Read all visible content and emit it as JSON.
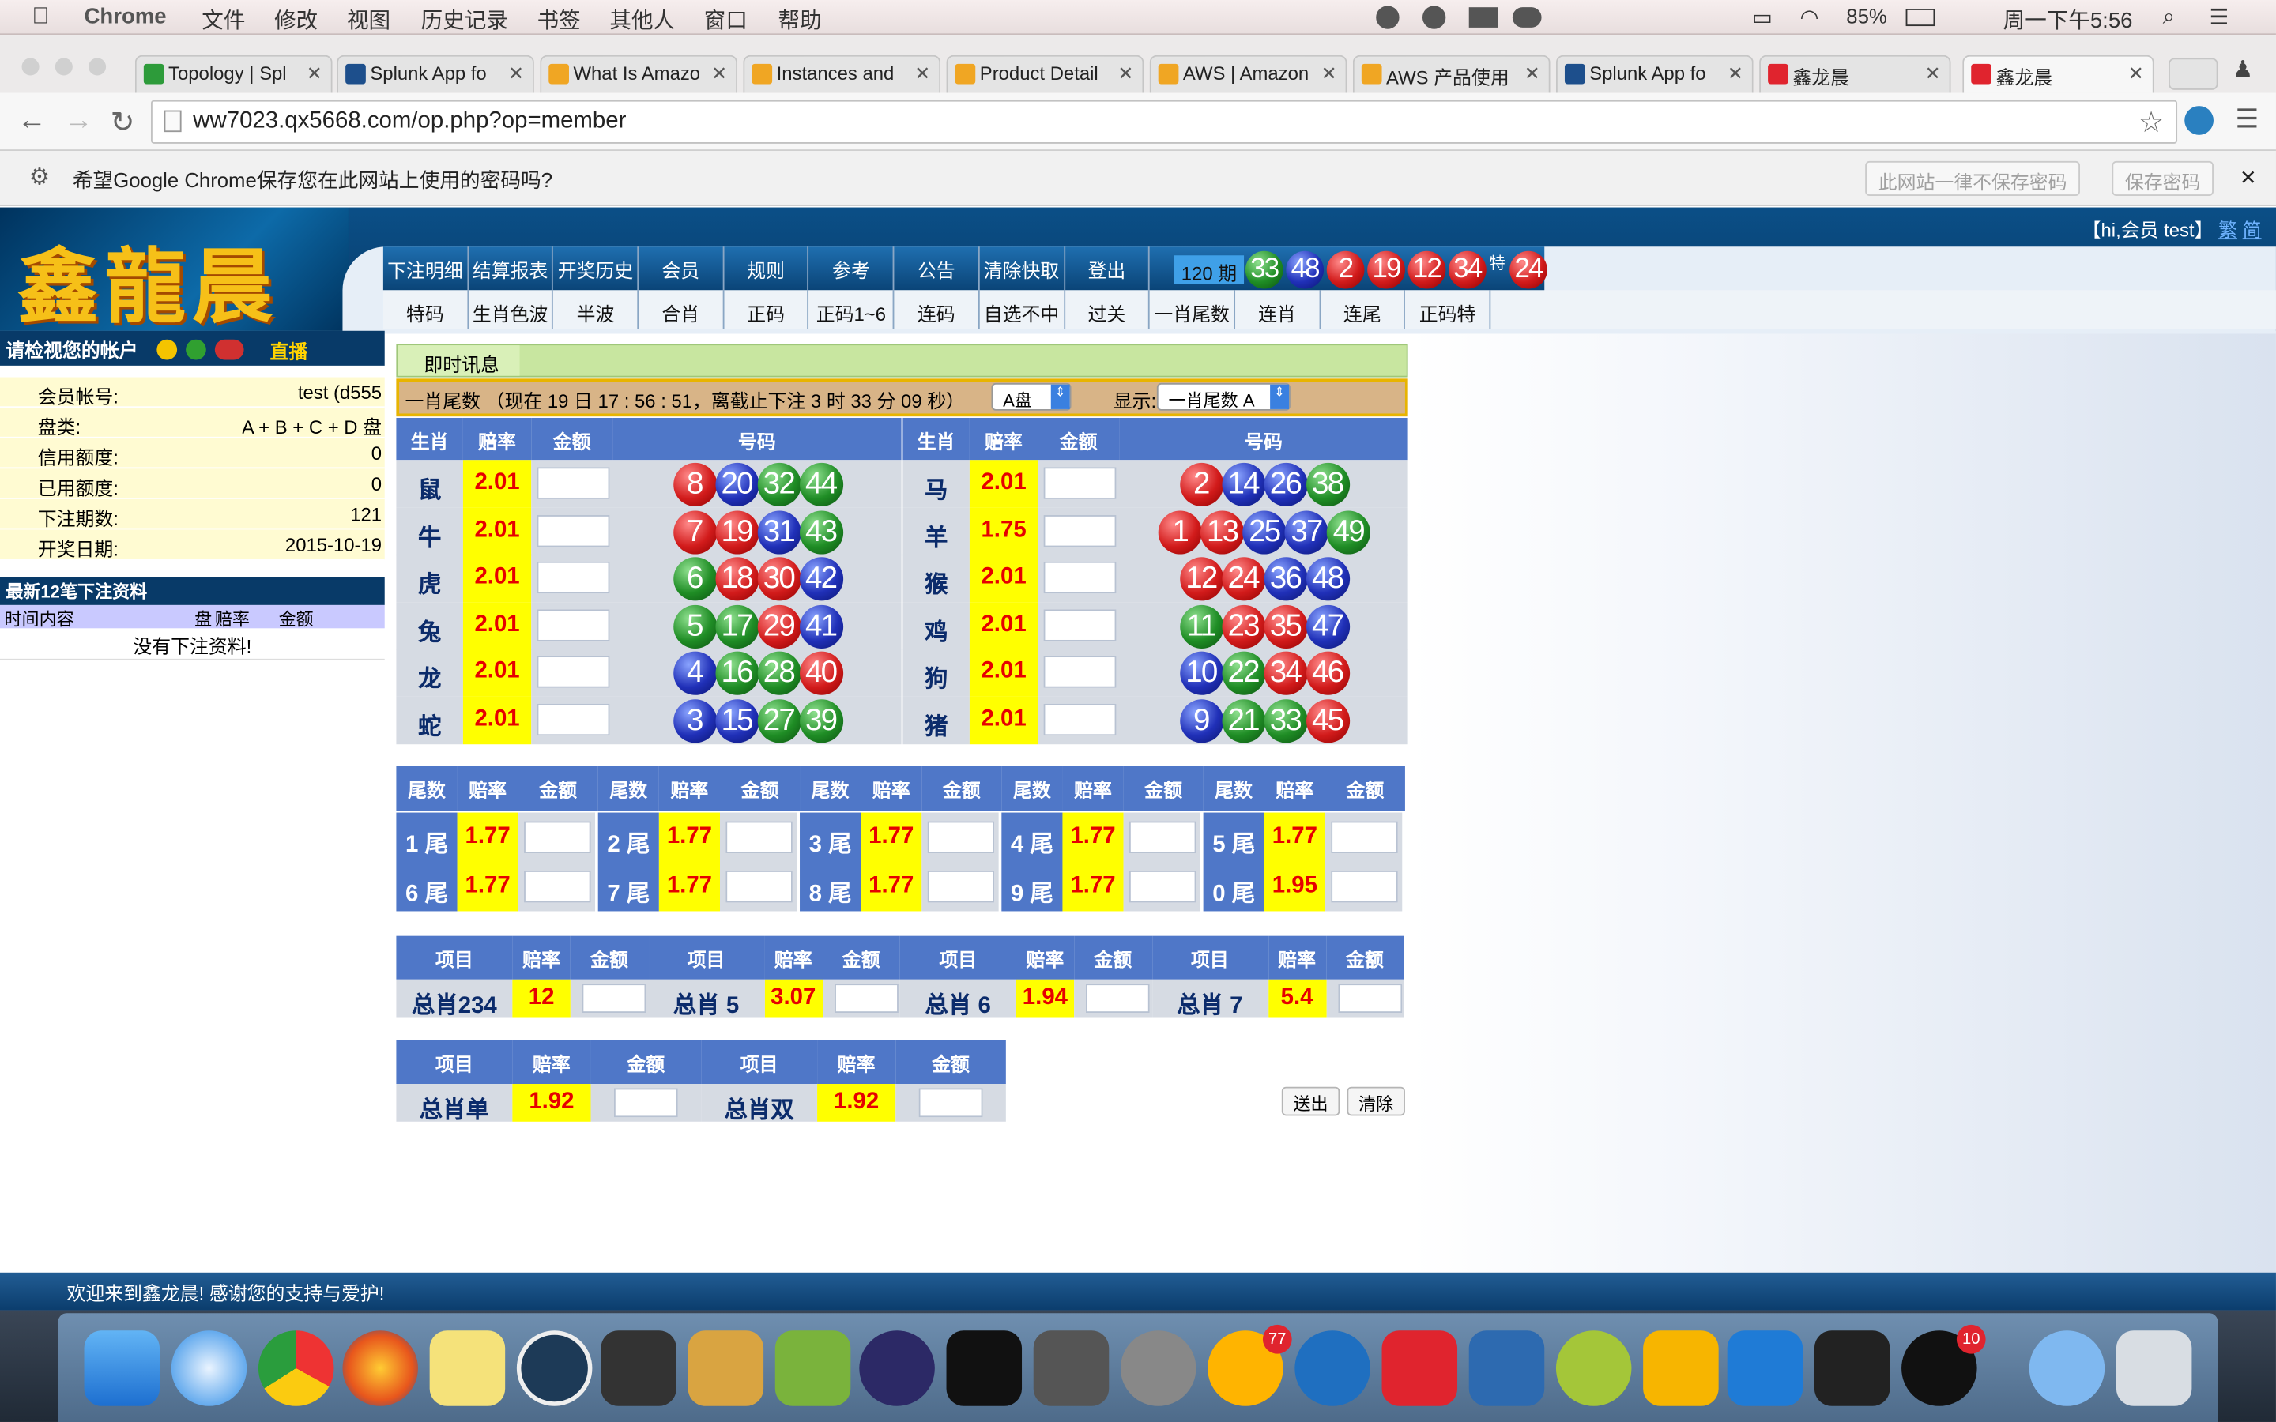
{
  "mac_menu": {
    "app": "Chrome",
    "items": [
      "文件",
      "修改",
      "视图",
      "历史记录",
      "书签",
      "其他人",
      "窗口",
      "帮助"
    ],
    "battery": "85%",
    "clock": "周一下午5:56"
  },
  "tabs": [
    {
      "label": "Topology | Spl",
      "color": "#2d9b3a"
    },
    {
      "label": "Splunk App fo",
      "color": "#1d4f8c"
    },
    {
      "label": "What Is Amazo",
      "color": "#f0a623"
    },
    {
      "label": "Instances and",
      "color": "#f0a623"
    },
    {
      "label": "Product Detail",
      "color": "#f0a623"
    },
    {
      "label": "AWS | Amazon",
      "color": "#f0a623"
    },
    {
      "label": "AWS 产品使用",
      "color": "#f0a623"
    },
    {
      "label": "Splunk App fo",
      "color": "#1d4f8c"
    },
    {
      "label": "鑫龙晨",
      "color": "#e0242e"
    },
    {
      "label": "鑫龙晨",
      "color": "#e0242e"
    }
  ],
  "url": "ww7023.qx5668.com/op.php?op=member",
  "pw_prompt": {
    "text": "希望Google Chrome保存您在此网站上使用的密码吗?",
    "never_btn": "此网站一律不保存密码",
    "save_btn": "保存密码"
  },
  "site": {
    "logo": "鑫龍晨",
    "user_greeting": "【hi,会员 test】",
    "trad": "繁",
    "simp": "简",
    "nav_top": [
      "下注明细",
      "结算报表",
      "开奖历史",
      "会员",
      "规则",
      "参考",
      "公告",
      "清除快取",
      "登出"
    ],
    "nav_bottom": [
      "特码",
      "生肖色波",
      "半波",
      "合肖",
      "正码",
      "正码1~6",
      "连码",
      "自选不中",
      "过关",
      "一肖尾数",
      "连肖",
      "连尾",
      "正码特"
    ],
    "draw_period": "120 期",
    "draw_balls": [
      {
        "n": "33",
        "c": "green"
      },
      {
        "n": "48",
        "c": "blue"
      },
      {
        "n": "2",
        "c": "red"
      },
      {
        "n": "19",
        "c": "red"
      },
      {
        "n": "12",
        "c": "red"
      },
      {
        "n": "34",
        "c": "red"
      }
    ],
    "special_label": "特",
    "special_ball": {
      "n": "24",
      "c": "red"
    }
  },
  "account": {
    "title": "请检视您的帐户",
    "live": "直播",
    "rows": [
      {
        "k": "会员帐号:",
        "v": "test (d555"
      },
      {
        "k": "盘类:",
        "v": "A + B + C + D 盘"
      },
      {
        "k": "信用额度:",
        "v": "0"
      },
      {
        "k": "已用额度:",
        "v": "0"
      },
      {
        "k": "下注期数:",
        "v": "121"
      },
      {
        "k": "开奖日期:",
        "v": "2015-10-19"
      }
    ],
    "recent_title": "最新12笔下注资料",
    "recent_cols": [
      "时间内容",
      "盘",
      "赔率",
      "金额"
    ],
    "no_data": "没有下注资料!"
  },
  "main": {
    "tab": "即时讯息",
    "status": "一肖尾数 （现在 19 日 17 : 56 : 51，离截止下注 3 时 33 分 09 秒）",
    "pan": "A盘",
    "show_label": "显示:",
    "show_value": "一肖尾数 A",
    "zodiac_cols": [
      "生肖",
      "赔率",
      "金额",
      "号码"
    ],
    "zodiac": [
      {
        "name": "鼠",
        "odds": "2.01",
        "balls": [
          [
            "8",
            "red"
          ],
          [
            "20",
            "blue"
          ],
          [
            "32",
            "green"
          ],
          [
            "44",
            "green"
          ]
        ]
      },
      {
        "name": "牛",
        "odds": "2.01",
        "balls": [
          [
            "7",
            "red"
          ],
          [
            "19",
            "red"
          ],
          [
            "31",
            "blue"
          ],
          [
            "43",
            "green"
          ]
        ]
      },
      {
        "name": "虎",
        "odds": "2.01",
        "balls": [
          [
            "6",
            "green"
          ],
          [
            "18",
            "red"
          ],
          [
            "30",
            "red"
          ],
          [
            "42",
            "blue"
          ]
        ]
      },
      {
        "name": "兔",
        "odds": "2.01",
        "balls": [
          [
            "5",
            "green"
          ],
          [
            "17",
            "green"
          ],
          [
            "29",
            "red"
          ],
          [
            "41",
            "blue"
          ]
        ]
      },
      {
        "name": "龙",
        "odds": "2.01",
        "balls": [
          [
            "4",
            "blue"
          ],
          [
            "16",
            "green"
          ],
          [
            "28",
            "green"
          ],
          [
            "40",
            "red"
          ]
        ]
      },
      {
        "name": "蛇",
        "odds": "2.01",
        "balls": [
          [
            "3",
            "blue"
          ],
          [
            "15",
            "blue"
          ],
          [
            "27",
            "green"
          ],
          [
            "39",
            "green"
          ]
        ]
      },
      {
        "name": "马",
        "odds": "2.01",
        "balls": [
          [
            "2",
            "red"
          ],
          [
            "14",
            "blue"
          ],
          [
            "26",
            "blue"
          ],
          [
            "38",
            "green"
          ]
        ]
      },
      {
        "name": "羊",
        "odds": "1.75",
        "balls": [
          [
            "1",
            "red"
          ],
          [
            "13",
            "red"
          ],
          [
            "25",
            "blue"
          ],
          [
            "37",
            "blue"
          ],
          [
            "49",
            "green"
          ]
        ]
      },
      {
        "name": "猴",
        "odds": "2.01",
        "balls": [
          [
            "12",
            "red"
          ],
          [
            "24",
            "red"
          ],
          [
            "36",
            "blue"
          ],
          [
            "48",
            "blue"
          ]
        ]
      },
      {
        "name": "鸡",
        "odds": "2.01",
        "balls": [
          [
            "11",
            "green"
          ],
          [
            "23",
            "red"
          ],
          [
            "35",
            "red"
          ],
          [
            "47",
            "blue"
          ]
        ]
      },
      {
        "name": "狗",
        "odds": "2.01",
        "balls": [
          [
            "10",
            "blue"
          ],
          [
            "22",
            "green"
          ],
          [
            "34",
            "red"
          ],
          [
            "46",
            "red"
          ]
        ]
      },
      {
        "name": "猪",
        "odds": "2.01",
        "balls": [
          [
            "9",
            "blue"
          ],
          [
            "21",
            "green"
          ],
          [
            "33",
            "green"
          ],
          [
            "45",
            "red"
          ]
        ]
      }
    ],
    "tail_cols": [
      "尾数",
      "赔率",
      "金额"
    ],
    "tails": [
      {
        "k": "1 尾",
        "o": "1.77"
      },
      {
        "k": "2 尾",
        "o": "1.77"
      },
      {
        "k": "3 尾",
        "o": "1.77"
      },
      {
        "k": "4 尾",
        "o": "1.77"
      },
      {
        "k": "5 尾",
        "o": "1.77"
      },
      {
        "k": "6 尾",
        "o": "1.77"
      },
      {
        "k": "7 尾",
        "o": "1.77"
      },
      {
        "k": "8 尾",
        "o": "1.77"
      },
      {
        "k": "9 尾",
        "o": "1.77"
      },
      {
        "k": "0 尾",
        "o": "1.95"
      }
    ],
    "total_cols": [
      "项目",
      "赔率",
      "金额"
    ],
    "totals": [
      {
        "k": "总肖234",
        "o": "12"
      },
      {
        "k": "总肖 5",
        "o": "3.07"
      },
      {
        "k": "总肖 6",
        "o": "1.94"
      },
      {
        "k": "总肖 7",
        "o": "5.4"
      }
    ],
    "parity": [
      {
        "k": "总肖单",
        "o": "1.92"
      },
      {
        "k": "总肖双",
        "o": "1.92"
      }
    ],
    "submit": "送出",
    "clear": "清除"
  },
  "footer": "欢迎来到鑫龙晨! 感谢您的支持与爱护!",
  "dock_badges": {
    "opera": "77",
    "qq": "10"
  }
}
